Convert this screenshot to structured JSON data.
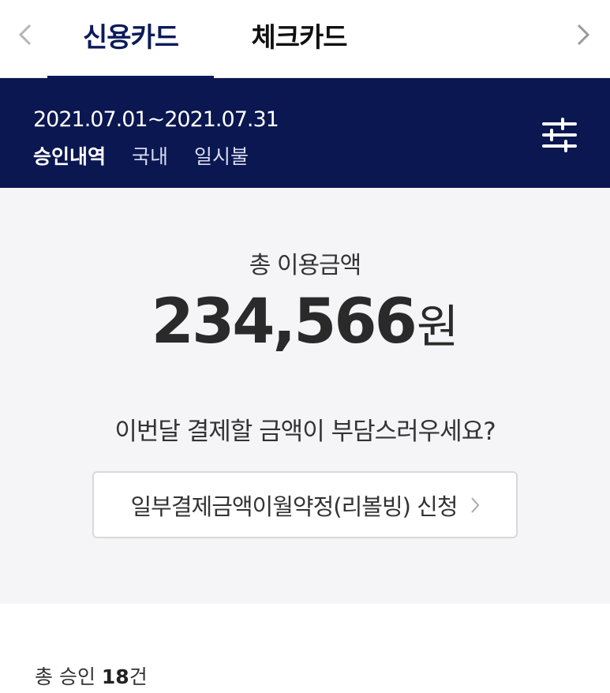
{
  "tabs": {
    "prev_icon": "chevron-left-icon",
    "next_icon": "chevron-right-icon",
    "items": [
      {
        "label": "신용카드",
        "active": true
      },
      {
        "label": "체크카드",
        "active": false
      }
    ]
  },
  "banner": {
    "period": "2021.07.01~2021.07.31",
    "filters": [
      "승인내역",
      "국내",
      "일시불"
    ],
    "filter_icon": "sliders-icon"
  },
  "summary": {
    "total_label": "총 이용금액",
    "total_amount": "234,566",
    "currency": "원",
    "question": "이번달 결제할 금액이 부담스러우세요?",
    "revolving_button": "일부결제금액이월약정(리볼빙) 신청"
  },
  "count": {
    "prefix": "총 승인 ",
    "number": "18",
    "suffix": "건"
  },
  "colors": {
    "navy": "#0b1750",
    "active_tab": "#0b1b5a",
    "summary_bg": "#f5f5f7"
  }
}
